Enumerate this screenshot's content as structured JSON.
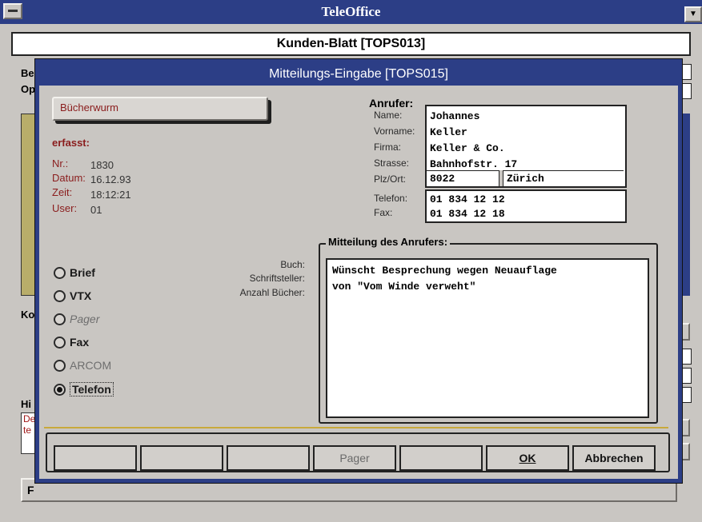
{
  "app": {
    "title": "TeleOffice"
  },
  "parent": {
    "title": "Kunden-Blatt  [TOPS013]",
    "left_labels": [
      "Be",
      "Op",
      "Ko",
      "Hi"
    ],
    "history_snippet": [
      "De",
      "te"
    ],
    "bottom_button_initial": "F"
  },
  "dialog": {
    "title": "Mitteilungs-Eingabe  [TOPS015]",
    "category_value": "Bücherwurm",
    "erfasst": {
      "heading": "erfasst:",
      "rows": [
        {
          "label": "Nr.:",
          "value": "1830"
        },
        {
          "label": "Datum:",
          "value": "16.12.93"
        },
        {
          "label": "Zeit:",
          "value": "18:12:21"
        },
        {
          "label": "User:",
          "value": "01"
        }
      ]
    },
    "caller": {
      "heading": "Anrufer:",
      "name_label": "Name:",
      "name": "Johannes",
      "vorname_label": "Vorname:",
      "vorname": "Keller",
      "firma_label": "Firma:",
      "firma": "Keller & Co.",
      "strasse_label": "Strasse:",
      "strasse": "Bahnhofstr. 17",
      "plz_label": "Plz/Ort:",
      "plz": "8022",
      "ort": "Zürich",
      "telefon_label": "Telefon:",
      "telefon": "01 834 12 12",
      "fax_label": "Fax:",
      "fax": "01 834 12 18"
    },
    "channels": [
      {
        "label": "Brief",
        "selected": false,
        "enabled": true
      },
      {
        "label": "VTX",
        "selected": false,
        "enabled": true
      },
      {
        "label": "Pager",
        "selected": false,
        "enabled": false
      },
      {
        "label": "Fax",
        "selected": false,
        "enabled": true
      },
      {
        "label": "ARCOM",
        "selected": false,
        "enabled": false
      },
      {
        "label": "Telefon",
        "selected": true,
        "enabled": true
      }
    ],
    "book_fields": {
      "buch": "Buch:",
      "schriftsteller": "Schriftsteller:",
      "anzahl": "Anzahl Bücher:"
    },
    "message": {
      "heading": "Mitteilung des Anrufers:",
      "line1": "Wünscht Besprechung wegen Neuauflage",
      "line2": "von \"Vom Winde verweht\""
    },
    "buttons": {
      "pager": "Pager",
      "ok": "OK",
      "cancel": "Abbrechen"
    }
  }
}
